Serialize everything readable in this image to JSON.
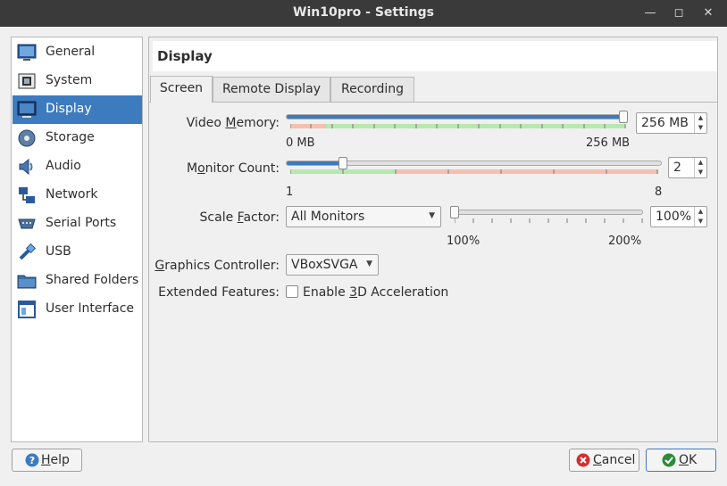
{
  "window": {
    "title": "Win10pro - Settings"
  },
  "sidebar": {
    "items": [
      {
        "label": "General",
        "icon": "general-icon"
      },
      {
        "label": "System",
        "icon": "system-icon"
      },
      {
        "label": "Display",
        "icon": "display-icon",
        "selected": true
      },
      {
        "label": "Storage",
        "icon": "storage-icon"
      },
      {
        "label": "Audio",
        "icon": "audio-icon"
      },
      {
        "label": "Network",
        "icon": "network-icon"
      },
      {
        "label": "Serial Ports",
        "icon": "serial-ports-icon"
      },
      {
        "label": "USB",
        "icon": "usb-icon"
      },
      {
        "label": "Shared Folders",
        "icon": "shared-folders-icon"
      },
      {
        "label": "User Interface",
        "icon": "user-interface-icon"
      }
    ]
  },
  "page": {
    "title": "Display"
  },
  "tabs": [
    {
      "label": "Screen",
      "active": true
    },
    {
      "label": "Remote Display",
      "active": false
    },
    {
      "label": "Recording",
      "active": false
    }
  ],
  "screen": {
    "video_memory": {
      "label_pre": "Video ",
      "label_key": "M",
      "label_post": "emory:",
      "value": "256 MB",
      "min_label": "0 MB",
      "max_label": "256 MB",
      "level": 1.0
    },
    "monitor_count": {
      "label_pre": "M",
      "label_key": "o",
      "label_post": "nitor Count:",
      "value": "2",
      "min_label": "1",
      "max_label": "8",
      "level": 0.142857
    },
    "scale_factor": {
      "label_pre": "Scale ",
      "label_key": "F",
      "label_post": "actor:",
      "monitors": "All Monitors",
      "value": "100%",
      "min_label": "100%",
      "max_label": "200%",
      "level": 0.0
    },
    "graphics_controller": {
      "label_pre": "",
      "label_key": "G",
      "label_post": "raphics Controller:",
      "value": "VBoxSVGA"
    },
    "extended_features": {
      "label": "Extended Features:",
      "checkbox_pre": "Enable ",
      "checkbox_key": "3",
      "checkbox_post": "D Acceleration",
      "checked": false
    }
  },
  "buttons": {
    "help_key": "H",
    "help_rest": "elp",
    "cancel_key": "C",
    "cancel_rest": "ancel",
    "ok_key": "O",
    "ok_rest": "K"
  },
  "colors": {
    "accent": "#3d7bbf",
    "good_zone": "#b7e8b0",
    "bad_zone": "#f5c0b0"
  }
}
